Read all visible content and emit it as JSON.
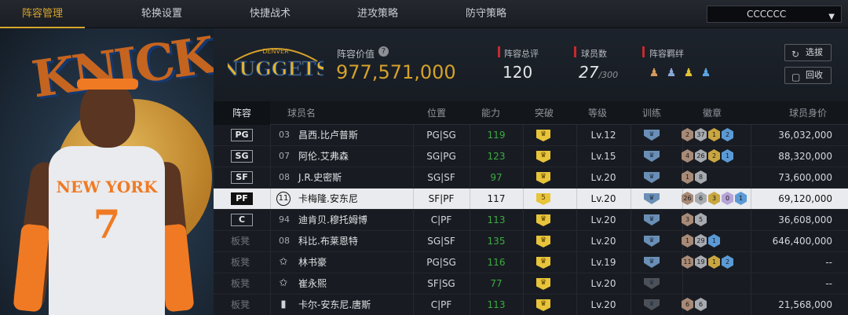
{
  "tabs": [
    "阵容管理",
    "轮换设置",
    "快捷战术",
    "进攻策略",
    "防守策略"
  ],
  "team_select": {
    "value": "CCCCCC"
  },
  "header": {
    "logo_text": "NUGGETS",
    "logo_small": "DENVER",
    "lineup_value_label": "阵容价值",
    "lineup_value": "977,571,000",
    "overall_label": "阵容总评",
    "overall_value": "120",
    "players_label": "球员数",
    "players_value": "27",
    "players_max": "/300",
    "bond_label": "阵容羁绊",
    "bond_icons": [
      "bond-icon-1",
      "bond-icon-2",
      "bond-icon-3",
      "bond-icon-4"
    ],
    "btn_pick": "选拔",
    "btn_recycle": "回收"
  },
  "left_panel": {
    "jersey_team": "NEW YORK",
    "jersey_number": "7",
    "bg_text": "KNICKS"
  },
  "columns": [
    "阵容",
    "球员名",
    "位置",
    "能力",
    "突破",
    "等级",
    "训练",
    "徽章",
    "球员身价"
  ],
  "rows": [
    {
      "slot": "PG",
      "num": "03",
      "name": "昌西.比卢普斯",
      "position": "PG|SG",
      "ability": "119",
      "breakthrough": "",
      "level": "Lv.12",
      "training": "blue",
      "badges": [
        {
          "v": "2",
          "c": "#a88a76"
        },
        {
          "v": "37",
          "c": "#a7abb0"
        },
        {
          "v": "1",
          "c": "#c9a640"
        },
        {
          "v": "2",
          "c": "#5a9ad6"
        }
      ],
      "value": "36,032,000",
      "green": true,
      "selected": false
    },
    {
      "slot": "SG",
      "num": "07",
      "name": "阿伦.艾弗森",
      "position": "SG|PG",
      "ability": "123",
      "breakthrough": "",
      "level": "Lv.15",
      "training": "blue",
      "badges": [
        {
          "v": "4",
          "c": "#a88a76"
        },
        {
          "v": "26",
          "c": "#a7abb0"
        },
        {
          "v": "2",
          "c": "#c9a640"
        },
        {
          "v": "1",
          "c": "#5a9ad6"
        }
      ],
      "value": "88,320,000",
      "green": true,
      "selected": false
    },
    {
      "slot": "SF",
      "num": "08",
      "name": "J.R.史密斯",
      "position": "SG|SF",
      "ability": "97",
      "breakthrough": "",
      "level": "Lv.20",
      "training": "blue",
      "badges": [
        {
          "v": "1",
          "c": "#a88a76"
        },
        {
          "v": "8",
          "c": "#a7abb0"
        }
      ],
      "value": "73,600,000",
      "green": true,
      "selected": false
    },
    {
      "slot": "PF",
      "num": "11",
      "name": "卡梅隆.安东尼",
      "position": "SF|PF",
      "ability": "117",
      "breakthrough": "5",
      "level": "Lv.20",
      "training": "blue",
      "badges": [
        {
          "v": "26",
          "c": "#a88a76"
        },
        {
          "v": "6",
          "c": "#a7abb0"
        },
        {
          "v": "3",
          "c": "#c9a640"
        },
        {
          "v": "0",
          "c": "#b6a3d8"
        },
        {
          "v": "1",
          "c": "#5a9ad6"
        }
      ],
      "value": "69,120,000",
      "green": false,
      "selected": true
    },
    {
      "slot": "C",
      "num": "94",
      "name": "迪肯贝.穆托姆博",
      "position": "C|PF",
      "ability": "113",
      "breakthrough": "",
      "level": "Lv.20",
      "training": "blue",
      "badges": [
        {
          "v": "3",
          "c": "#a88a76"
        },
        {
          "v": "5",
          "c": "#a7abb0"
        }
      ],
      "value": "36,608,000",
      "green": true,
      "selected": false
    },
    {
      "slot": "板凳",
      "num": "08",
      "name": "科比.布莱恩特",
      "position": "SG|SF",
      "ability": "135",
      "breakthrough": "",
      "level": "Lv.20",
      "training": "blue",
      "badges": [
        {
          "v": "1",
          "c": "#a88a76"
        },
        {
          "v": "29",
          "c": "#a7abb0"
        },
        {
          "v": "1",
          "c": "#5a9ad6"
        }
      ],
      "value": "646,400,000",
      "green": true,
      "selected": false
    },
    {
      "slot": "板凳",
      "num": "star",
      "name": "林书豪",
      "position": "PG|SG",
      "ability": "116",
      "breakthrough": "",
      "level": "Lv.19",
      "training": "blue",
      "badges": [
        {
          "v": "11",
          "c": "#a88a76"
        },
        {
          "v": "19",
          "c": "#a7abb0"
        },
        {
          "v": "1",
          "c": "#c9a640"
        },
        {
          "v": "2",
          "c": "#5a9ad6"
        }
      ],
      "value": "--",
      "green": true,
      "selected": false
    },
    {
      "slot": "板凳",
      "num": "star",
      "name": "崔永熙",
      "position": "SF|SG",
      "ability": "77",
      "breakthrough": "",
      "level": "Lv.20",
      "training": "dark",
      "badges": [],
      "value": "--",
      "green": true,
      "selected": false
    },
    {
      "slot": "板凳",
      "num": "bar",
      "name": "卡尔-安东尼.唐斯",
      "position": "C|PF",
      "ability": "113",
      "breakthrough": "",
      "level": "Lv.20",
      "training": "dark",
      "badges": [
        {
          "v": "6",
          "c": "#a88a76"
        },
        {
          "v": "6",
          "c": "#a7abb0"
        }
      ],
      "value": "21,568,000",
      "green": true,
      "selected": false
    }
  ]
}
